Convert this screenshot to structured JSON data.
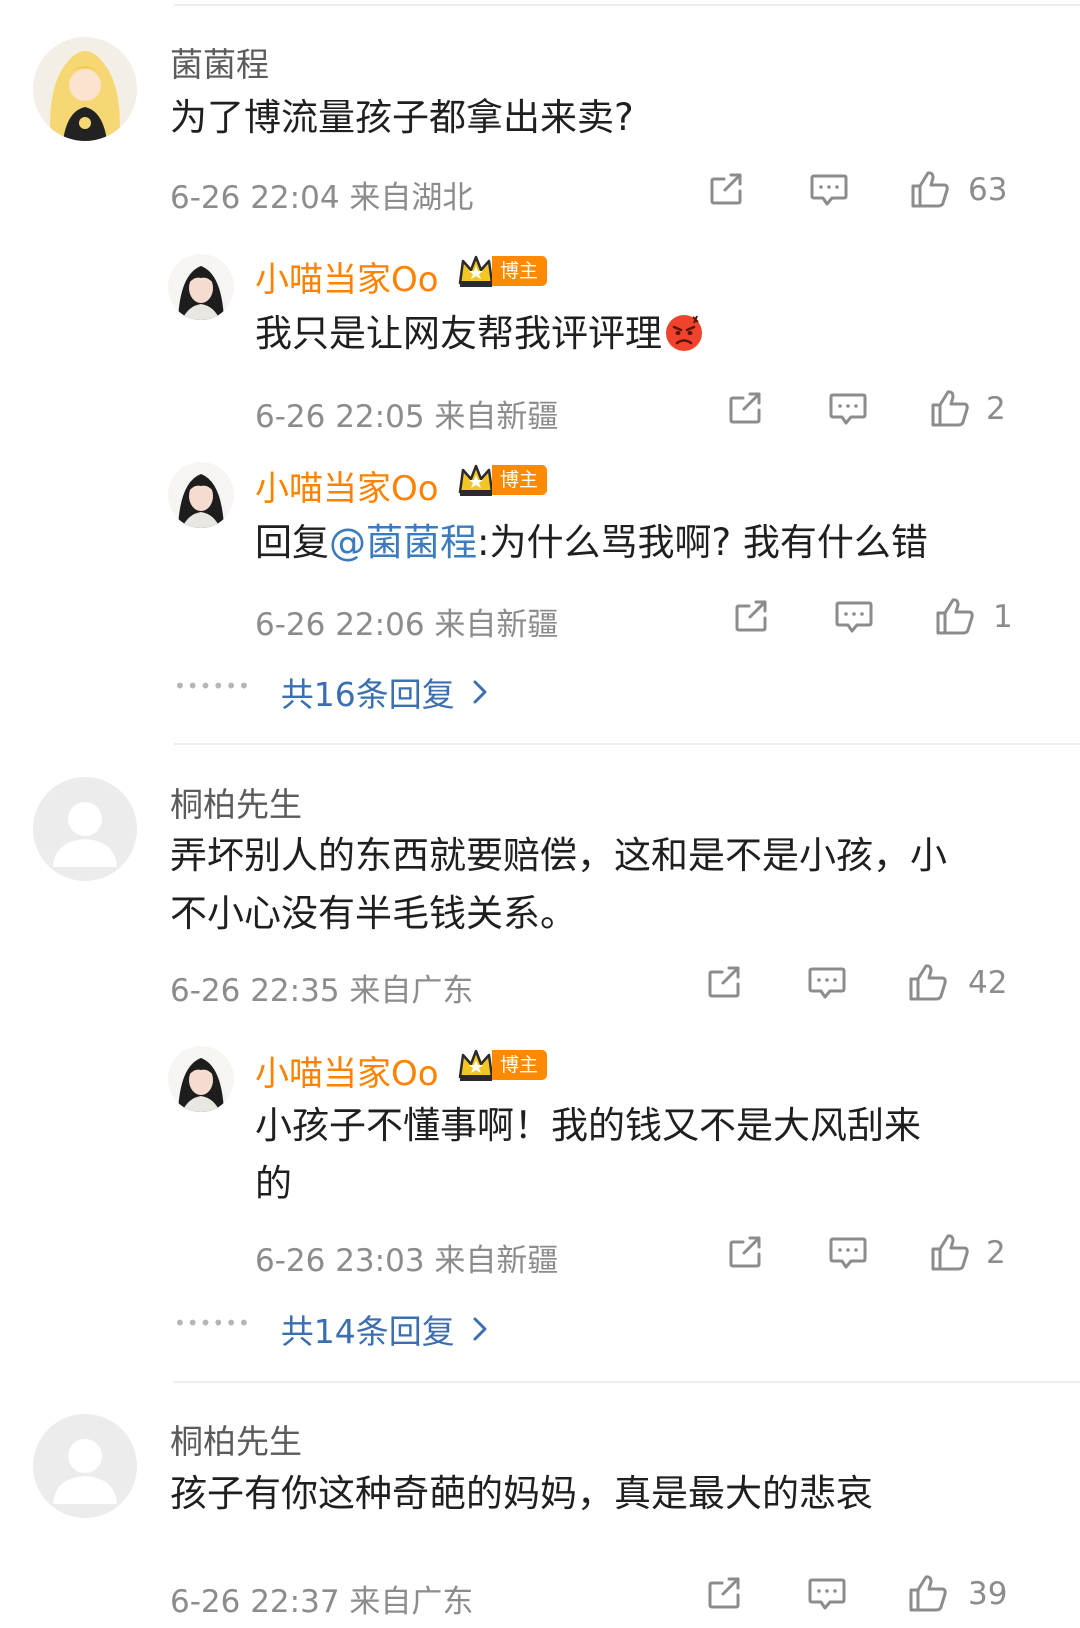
{
  "comments": [
    {
      "author": "菌菌程",
      "text": "为了博流量孩子都拿出来卖?",
      "time": "6-26 22:04",
      "location": "来自湖北",
      "likes": "63",
      "replies": [
        {
          "author": "小喵当家Oo",
          "badge": "博主",
          "lines": [
            "我只是让网友帮我评评理"
          ],
          "time": "6-26 22:05",
          "location": "来自新疆",
          "likes": "2"
        },
        {
          "author": "小喵当家Oo",
          "badge": "博主",
          "reply_prefix": "回复",
          "mention": "@菌菌程",
          "text_after_mention": ":为什么骂我啊? 我有什么错",
          "time": "6-26 22:06",
          "location": "来自新疆",
          "likes": "1"
        }
      ],
      "more_replies": "共16条回复"
    },
    {
      "author": "桐柏先生",
      "lines": [
        "弄坏别人的东西就要赔偿，这和是不是小孩，小",
        "不小心没有半毛钱关系。"
      ],
      "time": "6-26 22:35",
      "location": "来自广东",
      "likes": "42",
      "replies": [
        {
          "author": "小喵当家Oo",
          "badge": "博主",
          "lines": [
            "小孩子不懂事啊！我的钱又不是大风刮来",
            "的"
          ],
          "time": "6-26 23:03",
          "location": "来自新疆",
          "likes": "2"
        }
      ],
      "more_replies": "共14条回复"
    },
    {
      "author": "桐柏先生",
      "text": "孩子有你这种奇葩的妈妈，真是最大的悲哀",
      "time": "6-26 22:37",
      "location": "来自广东",
      "likes": "39"
    }
  ],
  "icons": {
    "share": "share-icon",
    "comment": "comment-icon",
    "like": "thumbs-up-icon",
    "crown": "crown-icon",
    "chevron": "chevron-right-icon",
    "angry_emoji": "angry-face-emoji"
  },
  "colors": {
    "name_gray": "#5b5b5b",
    "blogger_orange": "#ff8200",
    "link_blue": "#3b6fb2",
    "meta_gray": "#8c8c8c"
  }
}
